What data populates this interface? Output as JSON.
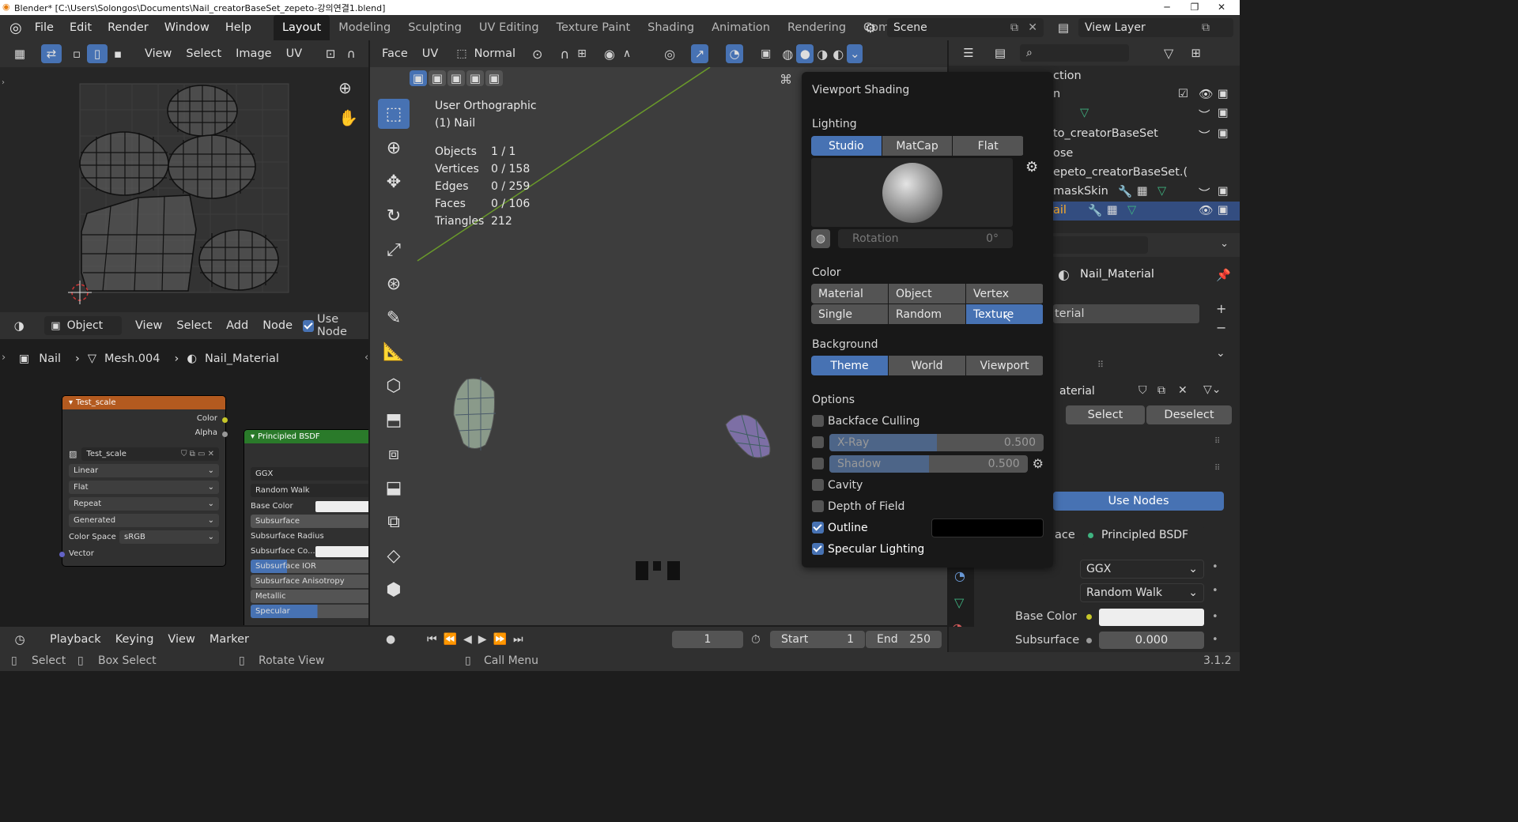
{
  "window": {
    "title": "Blender* [C:\\Users\\Solongos\\Documents\\Nail_creatorBaseSet_zepeto-강의연결1.blend]",
    "minimize": "─",
    "maximize": "❐",
    "close": "✕"
  },
  "menu": [
    "File",
    "Edit",
    "Render",
    "Window",
    "Help"
  ],
  "workspaces": [
    "Layout",
    "Modeling",
    "Sculpting",
    "UV Editing",
    "Texture Paint",
    "Shading",
    "Animation",
    "Rendering",
    "Compo"
  ],
  "scene": "Scene",
  "view_layer": "View Layer",
  "uv_header": {
    "items": [
      "View",
      "Select",
      "Image",
      "UV"
    ]
  },
  "viewport_header": {
    "mode_items": [
      "Face",
      "UV"
    ],
    "orientation": "Normal"
  },
  "node_header": {
    "object": "Object",
    "items": [
      "View",
      "Select",
      "Add",
      "Node"
    ],
    "use_nodes": "Use Node"
  },
  "breadcrumb": [
    "Nail",
    "Mesh.004",
    "Nail_Material"
  ],
  "node_tex": {
    "title": "Test_scale",
    "outputs": [
      "Color",
      "Alpha"
    ],
    "image": "Test_scale",
    "interp": "Linear",
    "proj": "Flat",
    "ext": "Repeat",
    "src": "Generated",
    "cs_label": "Color Space",
    "cs_value": "sRGB",
    "input": "Vector"
  },
  "node_bsdf": {
    "title": "Principled BSDF",
    "dist": "GGX",
    "sss": "Random Walk",
    "rows": [
      "Base Color",
      "Subsurface",
      "Subsurface Radius",
      "Subsurface Co...",
      "Subsurface IOR",
      "Subsurface Anisotropy",
      "Metallic",
      "Specular"
    ]
  },
  "overlay": {
    "view_name": "User Orthographic",
    "object_name": "(1) Nail",
    "stats": [
      {
        "label": "Objects",
        "value": "1 / 1"
      },
      {
        "label": "Vertices",
        "value": "0 / 158"
      },
      {
        "label": "Edges",
        "value": "0 / 259"
      },
      {
        "label": "Faces",
        "value": "0 / 106"
      },
      {
        "label": "Triangles",
        "value": "212"
      }
    ]
  },
  "shading": {
    "title": "Viewport Shading",
    "lighting_label": "Lighting",
    "lighting": [
      "Studio",
      "MatCap",
      "Flat"
    ],
    "rotation_label": "Rotation",
    "rotation_value": "0°",
    "color_label": "Color",
    "colors": [
      "Material",
      "Object",
      "Vertex",
      "Single",
      "Random",
      "Texture"
    ],
    "background_label": "Background",
    "backgrounds": [
      "Theme",
      "World",
      "Viewport"
    ],
    "options_label": "Options",
    "backface": "Backface Culling",
    "xray": "X-Ray",
    "xray_value": "0.500",
    "xray_level": 0.5,
    "shadow": "Shadow",
    "shadow_value": "0.500",
    "shadow_level": 0.5,
    "cavity": "Cavity",
    "dof": "Depth of Field",
    "outline": "Outline",
    "specular": "Specular Lighting"
  },
  "outliner": {
    "rows": [
      "ction",
      "n",
      "",
      "to_creatorBaseSet",
      "ose",
      "epeto_creatorBaseSet.(",
      "maskSkin",
      "ail"
    ]
  },
  "properties": {
    "material_name": "Nail_Material",
    "slot": "terial",
    "mat_field": "aterial",
    "select": "Select",
    "deselect": "Deselect",
    "use_nodes": "Use Nodes",
    "surface_label": "ace",
    "surface_value": "Principled BSDF",
    "dist": "GGX",
    "sss": "Random Walk",
    "base_color": "Base Color",
    "subsurface": "Subsurface",
    "subsurface_value": "0.000"
  },
  "timeline": {
    "items": [
      "Playback",
      "Keying",
      "View",
      "Marker"
    ],
    "frame": "1",
    "start_label": "Start",
    "start": "1",
    "end_label": "End",
    "end": "250"
  },
  "statusbar": {
    "select": "Select",
    "box_select": "Box Select",
    "rotate": "Rotate View",
    "call_menu": "Call Menu",
    "version": "3.1.2"
  },
  "colors": {
    "accent": "#4772b3",
    "node_orange": "#b35a1f",
    "node_green": "#2a7a2a"
  }
}
